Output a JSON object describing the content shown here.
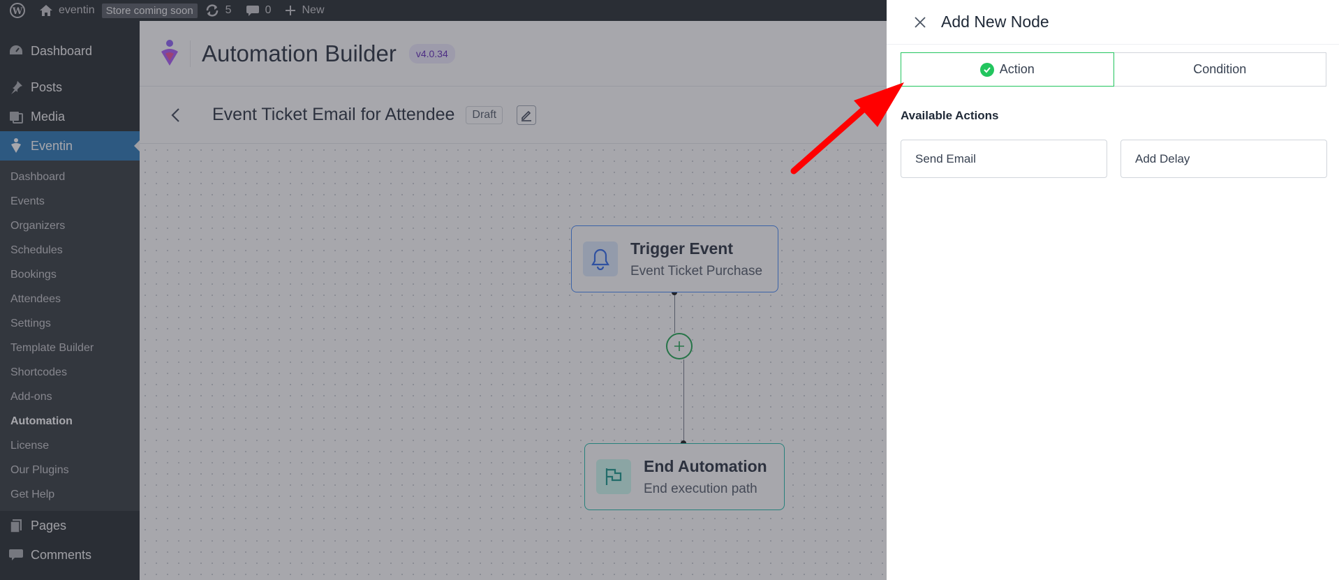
{
  "admin_bar": {
    "site_name": "eventin",
    "store_badge": "Store coming soon",
    "updates_count": "5",
    "comments_count": "0",
    "new_label": "New"
  },
  "sidebar": {
    "top_items": [
      {
        "label": "Dashboard",
        "icon": "dashboard-icon"
      },
      {
        "label": "Posts",
        "icon": "pin-icon"
      },
      {
        "label": "Media",
        "icon": "media-icon"
      },
      {
        "label": "Eventin",
        "icon": "eventin-icon"
      }
    ],
    "submenu": [
      "Dashboard",
      "Events",
      "Organizers",
      "Schedules",
      "Bookings",
      "Attendees",
      "Settings",
      "Template Builder",
      "Shortcodes",
      "Add-ons",
      "Automation",
      "License",
      "Our Plugins",
      "Get Help"
    ],
    "bottom_items": [
      {
        "label": "Pages",
        "icon": "pages-icon"
      },
      {
        "label": "Comments",
        "icon": "comments-icon"
      }
    ]
  },
  "header": {
    "title": "Automation Builder",
    "version": "v4.0.34"
  },
  "automation": {
    "title": "Event Ticket Email for Attendee",
    "status": "Draft"
  },
  "nodes": {
    "trigger": {
      "title": "Trigger Event",
      "subtitle": "Event Ticket Purchase",
      "icon": "bell-icon"
    },
    "end": {
      "title": "End Automation",
      "subtitle": "End execution path",
      "icon": "flag-icon"
    }
  },
  "drawer": {
    "title": "Add New Node",
    "tabs": [
      {
        "label": "Action",
        "active": true
      },
      {
        "label": "Condition",
        "active": false
      }
    ],
    "section_label": "Available Actions",
    "actions": [
      "Send Email",
      "Add Delay"
    ]
  },
  "colors": {
    "wp_dark": "#1d2327",
    "wp_blue": "#2271b1",
    "active_tab_border": "#22c55e",
    "trigger_border": "#3b82f6",
    "end_border": "#14b8a6",
    "annotation_arrow": "#ff0000"
  }
}
